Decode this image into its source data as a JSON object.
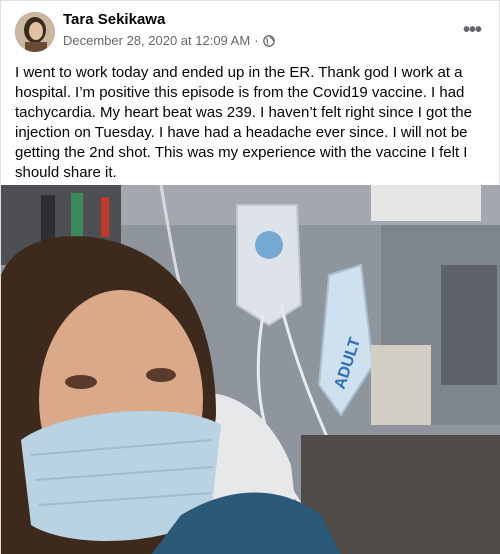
{
  "post": {
    "author": "Tara Sekikawa",
    "timestamp": "December 28, 2020 at 12:09 AM",
    "separator": "·",
    "privacy_icon": "globe-icon",
    "more_icon": "more-options-icon",
    "more_glyph": "•••",
    "text": "I went to work today and ended up in the ER. Thank god I work at a hospital. I’m positive this episode is from the Covid19 vaccine. I had tachycardia. My heart beat was 239. I haven’t felt right since I got the injection on Tuesday. I have had a headache ever since. I will not be getting the 2nd shot. This was my experience with the vaccine I felt I should share it.",
    "photo_bag_label": "ADULT"
  },
  "colors": {
    "name": "#050505",
    "secondary": "#65676b",
    "wall": "#9aa0a8",
    "scrubs": "#2b5a78",
    "mask": "#b9d3e2"
  }
}
